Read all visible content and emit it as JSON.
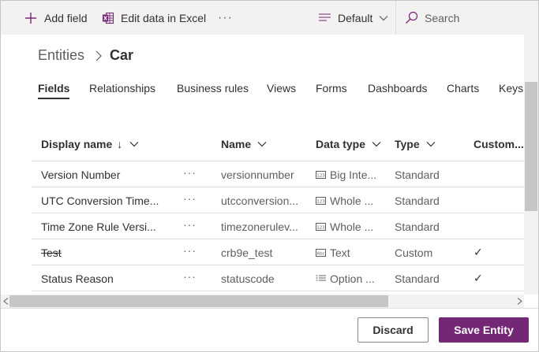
{
  "commandbar": {
    "add_field": "Add field",
    "edit_excel": "Edit data in Excel",
    "more": "···",
    "view": "Default",
    "search_placeholder": "Search"
  },
  "breadcrumb": {
    "parent": "Entities",
    "current": "Car"
  },
  "tabs": [
    "Fields",
    "Relationships",
    "Business rules",
    "Views",
    "Forms",
    "Dashboards",
    "Charts",
    "Keys"
  ],
  "active_tab": "Fields",
  "grid": {
    "columns": {
      "display_name": "Display name",
      "sort_arrow": "↓",
      "name": "Name",
      "data_type": "Data type",
      "type": "Type",
      "customizable": "Custom..."
    },
    "row_more": "···",
    "rows": [
      {
        "display": "Version Number",
        "name": "versionnumber",
        "data_type": "Big Inte...",
        "data_type_icon": "number-icon",
        "type": "Standard",
        "custom": "",
        "strikethrough": false
      },
      {
        "display": "UTC Conversion Time...",
        "name": "utcconversion...",
        "data_type": "Whole ...",
        "data_type_icon": "number-icon",
        "type": "Standard",
        "custom": "",
        "strikethrough": false
      },
      {
        "display": "Time Zone Rule Versi...",
        "name": "timezonerulev...",
        "data_type": "Whole ...",
        "data_type_icon": "number-icon",
        "type": "Standard",
        "custom": "",
        "strikethrough": false
      },
      {
        "display": "Test",
        "name": "crb9e_test",
        "data_type": "Text",
        "data_type_icon": "text-icon",
        "type": "Custom",
        "custom": "✓",
        "strikethrough": true
      },
      {
        "display": "Status Reason",
        "name": "statuscode",
        "data_type": "Option ...",
        "data_type_icon": "option-set-icon",
        "type": "Standard",
        "custom": "✓",
        "strikethrough": false
      }
    ]
  },
  "footer": {
    "discard": "Discard",
    "save": "Save Entity"
  },
  "colors": {
    "accent": "#742774",
    "commandbar_bg": "#f3f2f1"
  }
}
